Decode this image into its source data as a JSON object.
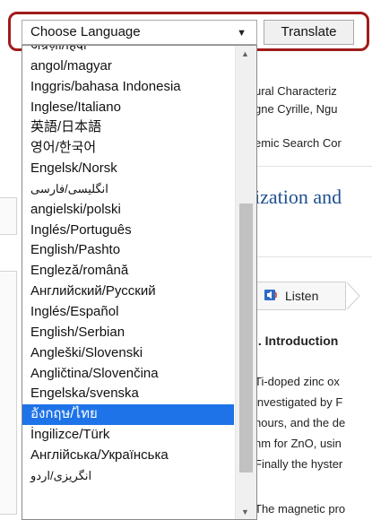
{
  "translate_bar": {
    "select_label": "Choose Language",
    "button_label": "Translate"
  },
  "dropdown": {
    "options": [
      "अंग्रेज़ी/हिंदी",
      "angol/magyar",
      "Inggris/bahasa Indonesia",
      "Inglese/Italiano",
      "英語/日本語",
      "영어/한국어",
      "Engelsk/Norsk",
      "انگلیسی/فارسی",
      "angielski/polski",
      "Inglés/Português",
      "English/Pashto",
      "Engleză/română",
      "Английский/Русский",
      "Inglés/Español",
      "English/Serbian",
      "Angleški/Slovenski",
      "Angličtina/Slovenčina",
      "Engelska/svenska",
      "อังกฤษ/ไทย",
      "İngilizce/Türk",
      "Англійська/Українська",
      "انگریزی/اردو"
    ],
    "selected_index": 18,
    "scroll_position": 0.82
  },
  "background_page": {
    "line1": "ural Characteriz",
    "line2": "gne Cyrille, Ngu",
    "line3": "emic Search Cor",
    "heading": "ization and",
    "listen_label": "Listen",
    "intro_title": "I. Introduction",
    "para_lines": [
      "Ti-doped zinc ox",
      "investigated by F",
      "hours, and the de",
      "nm for ZnO, usin",
      "Finally the hyster"
    ],
    "last_line": "The magnetic pro"
  },
  "colors": {
    "highlight_border": "#a11b1b",
    "selected_option": "#1e73e8",
    "heading_blue": "#1e4f8f"
  }
}
